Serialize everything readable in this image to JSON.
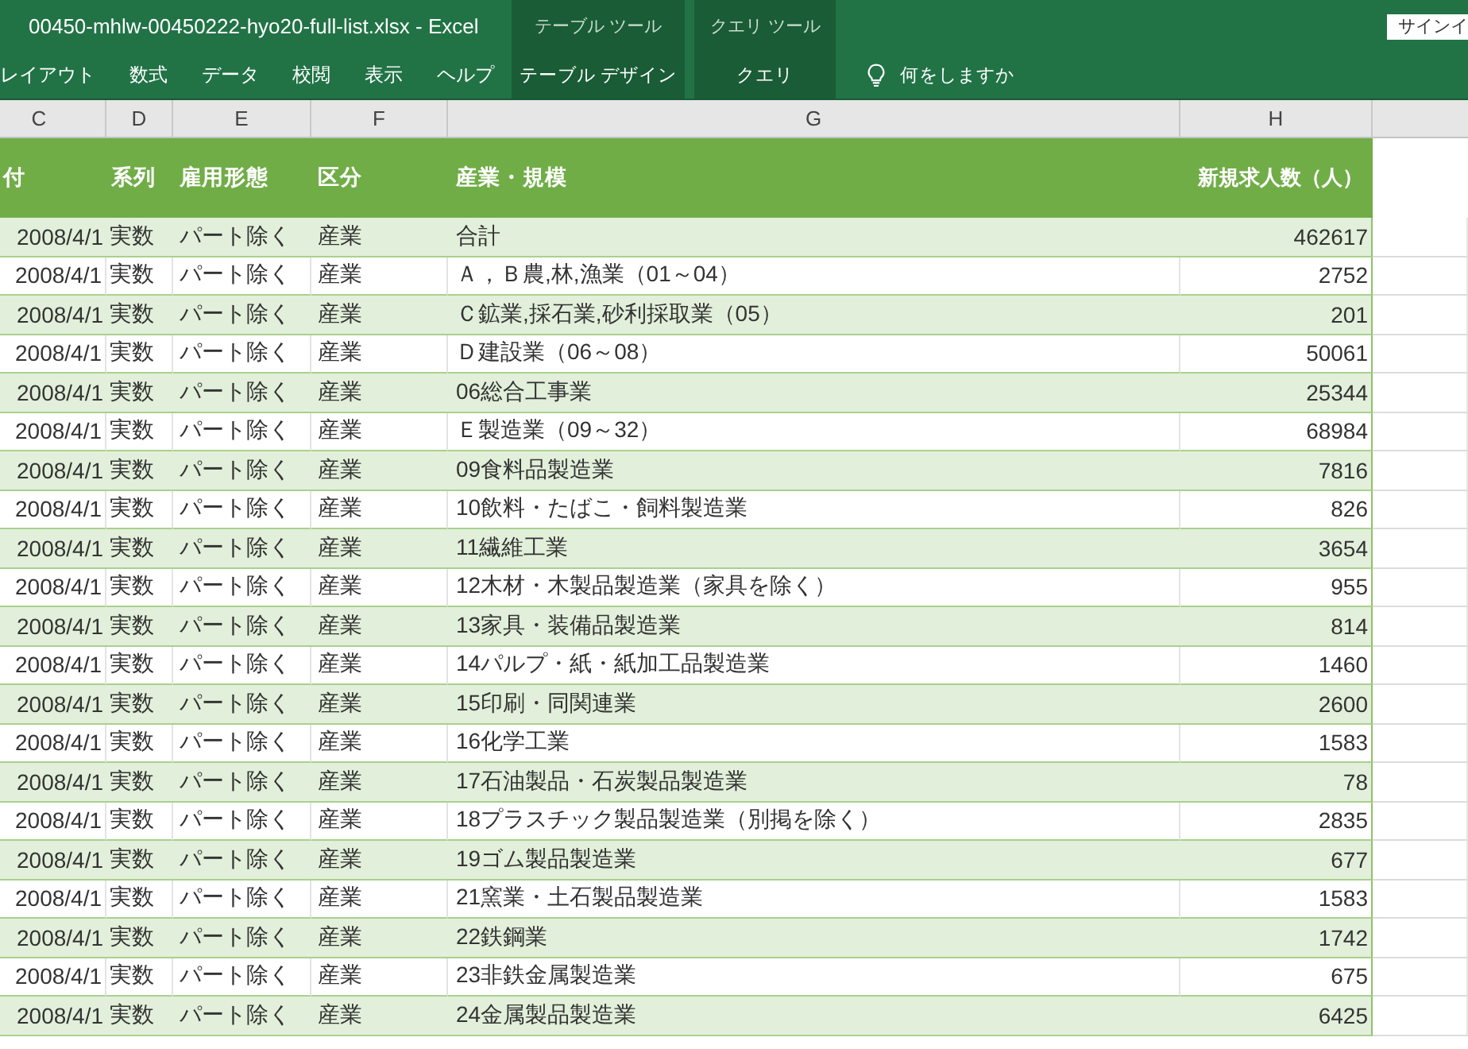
{
  "window": {
    "title": "00450-mhlw-00450222-hyo20-full-list.xlsx - Excel",
    "sign_in_button": "サインイ"
  },
  "ribbon_tabs": [
    {
      "label": "レイアウト",
      "kind": "standard",
      "selected": false
    },
    {
      "label": "数式",
      "kind": "standard",
      "selected": false
    },
    {
      "label": "データ",
      "kind": "standard",
      "selected": false
    },
    {
      "label": "校閲",
      "kind": "standard",
      "selected": false
    },
    {
      "label": "表示",
      "kind": "standard",
      "selected": false
    },
    {
      "label": "ヘルプ",
      "kind": "standard",
      "selected": false
    },
    {
      "label": "テーブル デザイン",
      "kind": "contextual",
      "group": "テーブル ツール",
      "selected": false
    },
    {
      "label": "クエリ",
      "kind": "contextual",
      "group": "クエリ ツール",
      "selected": false
    }
  ],
  "tell_me": {
    "label": "何をしますか"
  },
  "sheet": {
    "column_letters": [
      "C",
      "D",
      "E",
      "F",
      "G",
      "H"
    ],
    "table": {
      "columns": [
        "付",
        "系列",
        "雇用形態",
        "区分",
        "産業・規模",
        "新規求人数（人）"
      ],
      "rows": [
        [
          "2008/4/1",
          "実数",
          "パート除く",
          "産業",
          "合計",
          "462617"
        ],
        [
          "2008/4/1",
          "実数",
          "パート除く",
          "産業",
          "Ａ，Ｂ農,林,漁業（01～04）",
          "2752"
        ],
        [
          "2008/4/1",
          "実数",
          "パート除く",
          "産業",
          "Ｃ鉱業,採石業,砂利採取業（05）",
          "201"
        ],
        [
          "2008/4/1",
          "実数",
          "パート除く",
          "産業",
          "Ｄ建設業（06～08）",
          "50061"
        ],
        [
          "2008/4/1",
          "実数",
          "パート除く",
          "産業",
          "06総合工事業",
          "25344"
        ],
        [
          "2008/4/1",
          "実数",
          "パート除く",
          "産業",
          "Ｅ製造業（09～32）",
          "68984"
        ],
        [
          "2008/4/1",
          "実数",
          "パート除く",
          "産業",
          "09食料品製造業",
          "7816"
        ],
        [
          "2008/4/1",
          "実数",
          "パート除く",
          "産業",
          "10飲料・たばこ・飼料製造業",
          "826"
        ],
        [
          "2008/4/1",
          "実数",
          "パート除く",
          "産業",
          "11繊維工業",
          "3654"
        ],
        [
          "2008/4/1",
          "実数",
          "パート除く",
          "産業",
          "12木材・木製品製造業（家具を除く）",
          "955"
        ],
        [
          "2008/4/1",
          "実数",
          "パート除く",
          "産業",
          "13家具・装備品製造業",
          "814"
        ],
        [
          "2008/4/1",
          "実数",
          "パート除く",
          "産業",
          "14パルプ・紙・紙加工品製造業",
          "1460"
        ],
        [
          "2008/4/1",
          "実数",
          "パート除く",
          "産業",
          "15印刷・同関連業",
          "2600"
        ],
        [
          "2008/4/1",
          "実数",
          "パート除く",
          "産業",
          "16化学工業",
          "1583"
        ],
        [
          "2008/4/1",
          "実数",
          "パート除く",
          "産業",
          "17石油製品・石炭製品製造業",
          "78"
        ],
        [
          "2008/4/1",
          "実数",
          "パート除く",
          "産業",
          "18プラスチック製品製造業（別掲を除く）",
          "2835"
        ],
        [
          "2008/4/1",
          "実数",
          "パート除く",
          "産業",
          "19ゴム製品製造業",
          "677"
        ],
        [
          "2008/4/1",
          "実数",
          "パート除く",
          "産業",
          "21窯業・土石製品製造業",
          "1583"
        ],
        [
          "2008/4/1",
          "実数",
          "パート除く",
          "産業",
          "22鉄鋼業",
          "1742"
        ],
        [
          "2008/4/1",
          "実数",
          "パート除く",
          "産業",
          "23非鉄金属製造業",
          "675"
        ],
        [
          "2008/4/1",
          "実数",
          "パート除く",
          "産業",
          "24金属製品製造業",
          "6425"
        ]
      ]
    }
  }
}
